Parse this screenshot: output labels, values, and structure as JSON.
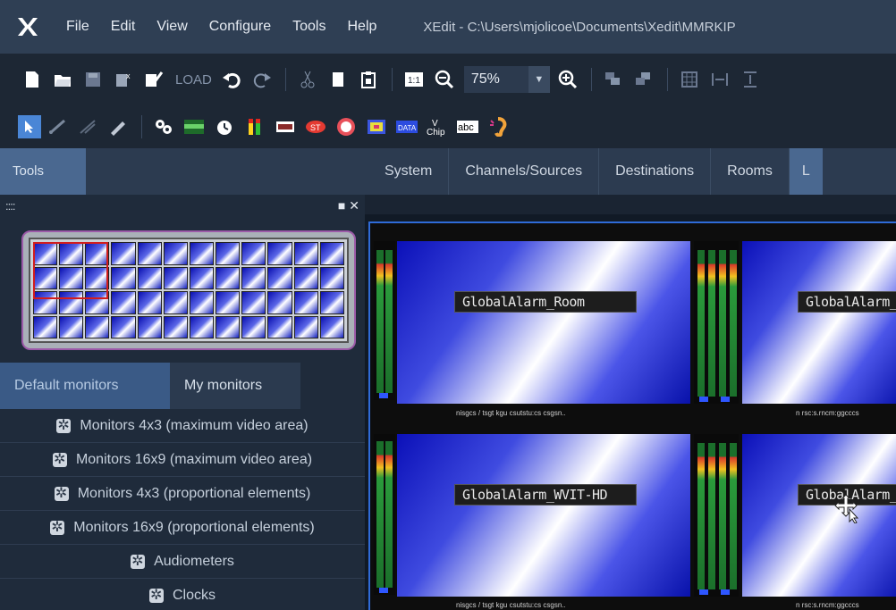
{
  "app": {
    "title": "XEdit - C:\\Users\\mjolicoe\\Documents\\Xedit\\MMRKIP"
  },
  "menu": {
    "items": [
      "File",
      "Edit",
      "View",
      "Configure",
      "Tools",
      "Help"
    ]
  },
  "toolbar": {
    "load_label": "LOAD",
    "zoom_value": "75%",
    "icons_row1": [
      "new-file-icon",
      "open-folder-icon",
      "save-icon",
      "close-doc-icon",
      "check-doc-icon",
      "undo-icon",
      "redo-icon",
      "cut-icon",
      "copy-icon",
      "paste-icon",
      "one-to-one-icon",
      "zoom-out-icon",
      "zoom-in-icon",
      "bring-front-icon",
      "send-back-icon",
      "grid-icon",
      "distribute-h-icon",
      "distribute-v-icon"
    ],
    "icons_row2": [
      "pointer-icon",
      "wire-icon",
      "wire-disabled-icon",
      "pen-icon",
      "properties-icon",
      "timecode-icon",
      "clock-icon",
      "audiometer-icon",
      "vu-icon",
      "st-icon",
      "alarm-icon",
      "logo-icon",
      "data-icon",
      "vchip-icon",
      "text-icon",
      "ear-icon"
    ]
  },
  "tabs": {
    "left": "Tools",
    "top": [
      "System",
      "Channels/Sources",
      "Destinations",
      "Rooms",
      "L"
    ]
  },
  "left_panel": {
    "grip": "::::",
    "monitor_tabs": [
      "Default monitors",
      "My monitors"
    ],
    "monitor_items": [
      "Monitors 4x3 (maximum video area)",
      "Monitors 16x9 (maximum video area)",
      "Monitors 4x3 (proportional elements)",
      "Monitors 16x9 (proportional elements)",
      "Audiometers",
      "Clocks"
    ]
  },
  "canvas": {
    "tiles": [
      {
        "label": "GlobalAlarm_Room",
        "footer": "nisgcs / tsgt kgu csutstu:cs csgsn.."
      },
      {
        "label": "GlobalAlarm_",
        "footer": "n rsc:s.rncm:ggcccs"
      },
      {
        "label": "GlobalAlarm_WVIT-HD",
        "footer": "nisgcs / tsgt kgu csutstu:cs csgsn.."
      },
      {
        "label": "GlobalAlarm_",
        "footer": "n rsc:s.rncm:ggcccs"
      }
    ]
  }
}
